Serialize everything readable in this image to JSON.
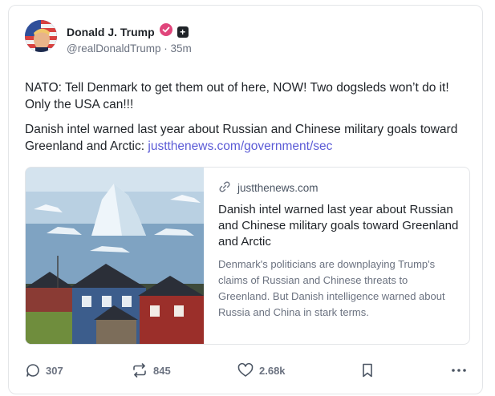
{
  "author": {
    "display_name": "Donald J. Trump",
    "handle": "@realDonaldTrump",
    "separator": "·",
    "time_ago": "35m",
    "plus_badge": "+",
    "verified_color": "#e0457b"
  },
  "post": {
    "paragraph_1": "NATO: Tell Denmark to get them out of here, NOW! Two dogsleds won’t do it! Only the USA can!!!",
    "paragraph_2": "Danish intel warned last year about Russian and Chinese military goals toward Greenland and Arctic: ",
    "link_text": "justthenews.com/government/sec",
    "link_color": "#5b5bd6"
  },
  "link_card": {
    "domain": "justthenews.com",
    "title": "Danish intel warned last year about Russian and Chinese military goals toward Greenland and Arctic",
    "description": "Denmark's politicians are downplaying Trump's claims of Russian and Chinese threats to Greenland. But Danish intelligence warned about Russia and China in stark terms.",
    "image_icon": "iceberg-town-photo"
  },
  "actions": {
    "replies": "307",
    "reposts": "845",
    "likes": "2.68k"
  },
  "icons": {
    "reply": "comment-icon",
    "repost": "repost-icon",
    "like": "heart-icon",
    "bookmark": "bookmark-icon",
    "more": "more-icon",
    "link": "link-icon",
    "verified": "verified-badge-icon"
  }
}
